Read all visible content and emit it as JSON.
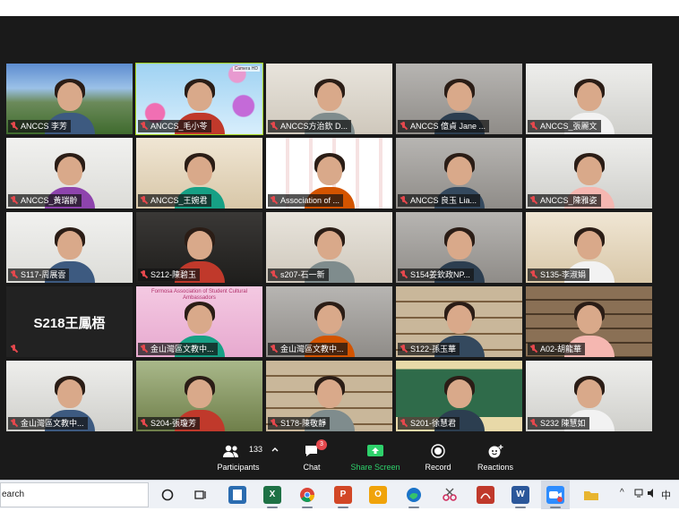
{
  "tiles": [
    {
      "name": "ANCCS 李芳",
      "scene": "mountain"
    },
    {
      "name": "ANCCS_毛小苓",
      "scene": "flowers",
      "active": true,
      "tag": "Camera HD"
    },
    {
      "name": "ANCCS方治欽 D...",
      "scene": "room-light"
    },
    {
      "name": "ANCCS 億貞  Jane ...",
      "scene": "room-grey"
    },
    {
      "name": "ANCCS_張麗文",
      "scene": "room-white"
    },
    {
      "name": "ANCCS_黃瑞齡",
      "scene": "whiteboard"
    },
    {
      "name": "ANCCS_王婉君",
      "scene": "room-warm"
    },
    {
      "name": "Association of ...",
      "scene": "logo-wall"
    },
    {
      "name": "ANCCS 良玉 Lia...",
      "scene": "room-grey"
    },
    {
      "name": "ANCCS_陳雅姿",
      "scene": "room-white"
    },
    {
      "name": "S117-周展雲",
      "scene": "whiteboard"
    },
    {
      "name": "S212-陳碧玉",
      "scene": "dark-room"
    },
    {
      "name": "s207-石一新",
      "scene": "room-light"
    },
    {
      "name": "S154姜欽政NP...",
      "scene": "room-grey"
    },
    {
      "name": "S135-李淑娟",
      "scene": "room-warm"
    },
    {
      "name": "",
      "scene": "name-only",
      "big_name": "S218王鳳梧"
    },
    {
      "name": "金山灣區文教中...",
      "scene": "pink-banner",
      "banner": "Formosa Association of Student Cultural Ambassadors"
    },
    {
      "name": "金山灣區文教中...",
      "scene": "room-grey"
    },
    {
      "name": "S122-孫玉華",
      "scene": "bookshelf"
    },
    {
      "name": "A02-胡龍華",
      "scene": "bookshelf-dark"
    },
    {
      "name": "金山灣區文教中...",
      "scene": "room-white"
    },
    {
      "name": "S204-張瓊芳",
      "scene": "outdoor"
    },
    {
      "name": "S178-陳敬靜",
      "scene": "bookshelf"
    },
    {
      "name": "S201-徐慧君",
      "scene": "chalkboard"
    },
    {
      "name": "S232 陳慧如",
      "scene": "room-white"
    }
  ],
  "toolbar": {
    "participants_count": "133",
    "participants_label": "Participants",
    "chat_label": "Chat",
    "chat_badge": "3",
    "share_label": "Share Screen",
    "record_label": "Record",
    "reactions_label": "Reactions"
  },
  "taskbar": {
    "search_text": "earch",
    "tray_chevron": "^",
    "ime_label": "中"
  },
  "colors": {
    "meeting_bg": "#1a1a1a",
    "active_border": "#a4d41c",
    "share_green": "#2ed16b",
    "muted_red": "#e5484d"
  }
}
